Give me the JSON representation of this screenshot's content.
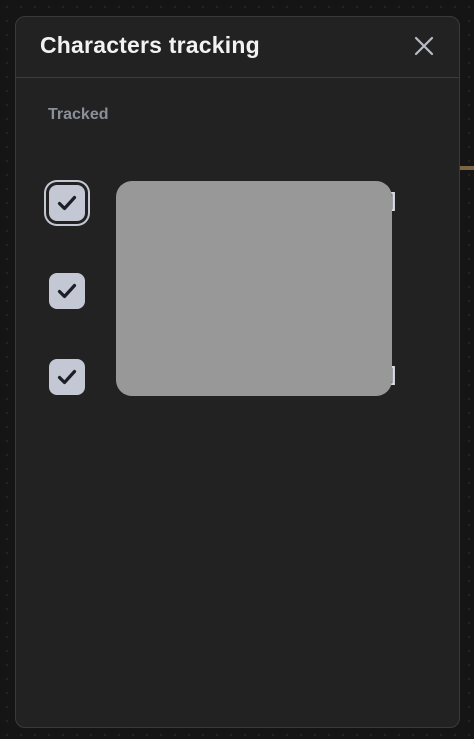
{
  "modal": {
    "title": "Characters tracking",
    "close_icon": "close-icon"
  },
  "section": {
    "label": "Tracked"
  },
  "characters": [
    {
      "checked": true,
      "focused": true,
      "name_suffix": "]"
    },
    {
      "checked": true,
      "focused": false,
      "name_suffix": ""
    },
    {
      "checked": true,
      "focused": false,
      "name_suffix": "-]"
    }
  ],
  "colors": {
    "modal_bg": "#222222",
    "checkbox_bg": "#c4c7d4",
    "check_mark": "#1c1f26",
    "section_label": "#8a8f99",
    "redaction": "#989898"
  }
}
